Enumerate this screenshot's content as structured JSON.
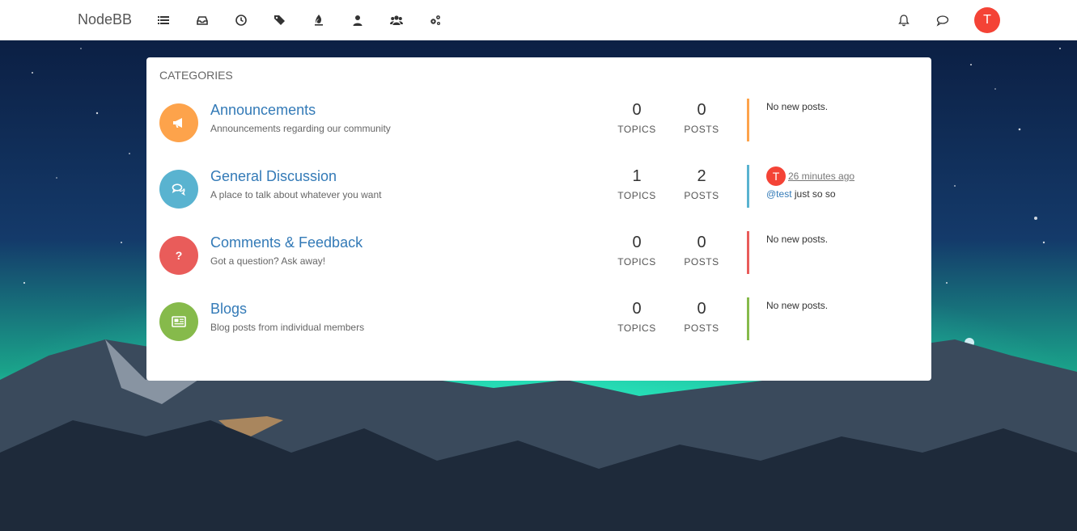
{
  "brand": "NodeBB",
  "nav": {
    "icons": [
      "categories-icon",
      "inbox-icon",
      "recent-icon",
      "tags-icon",
      "popular-icon",
      "users-icon",
      "groups-icon",
      "admin-icon"
    ],
    "right_icons": [
      "notifications-icon",
      "chat-icon"
    ],
    "user_avatar_letter": "T"
  },
  "panel": {
    "title": "CATEGORIES",
    "topics_label": "TOPICS",
    "posts_label": "POSTS",
    "categories": [
      {
        "name": "Announcements",
        "description": "Announcements regarding our community",
        "topics": "0",
        "posts": "0",
        "color": "#fda34b",
        "icon": "bullhorn-icon",
        "teaser_empty": "No new posts."
      },
      {
        "name": "General Discussion",
        "description": "A place to talk about whatever you want",
        "topics": "1",
        "posts": "2",
        "color": "#59b3d0",
        "icon": "comments-icon",
        "teaser": {
          "avatar_letter": "T",
          "time": "26 minutes ago",
          "user": "@test",
          "text": " just so so"
        }
      },
      {
        "name": "Comments & Feedback",
        "description": "Got a question? Ask away!",
        "topics": "0",
        "posts": "0",
        "color": "#e95c5a",
        "icon": "question-icon",
        "teaser_empty": "No new posts."
      },
      {
        "name": "Blogs",
        "description": "Blog posts from individual members",
        "topics": "0",
        "posts": "0",
        "color": "#86ba4b",
        "icon": "newspaper-icon",
        "teaser_empty": "No new posts."
      }
    ]
  }
}
